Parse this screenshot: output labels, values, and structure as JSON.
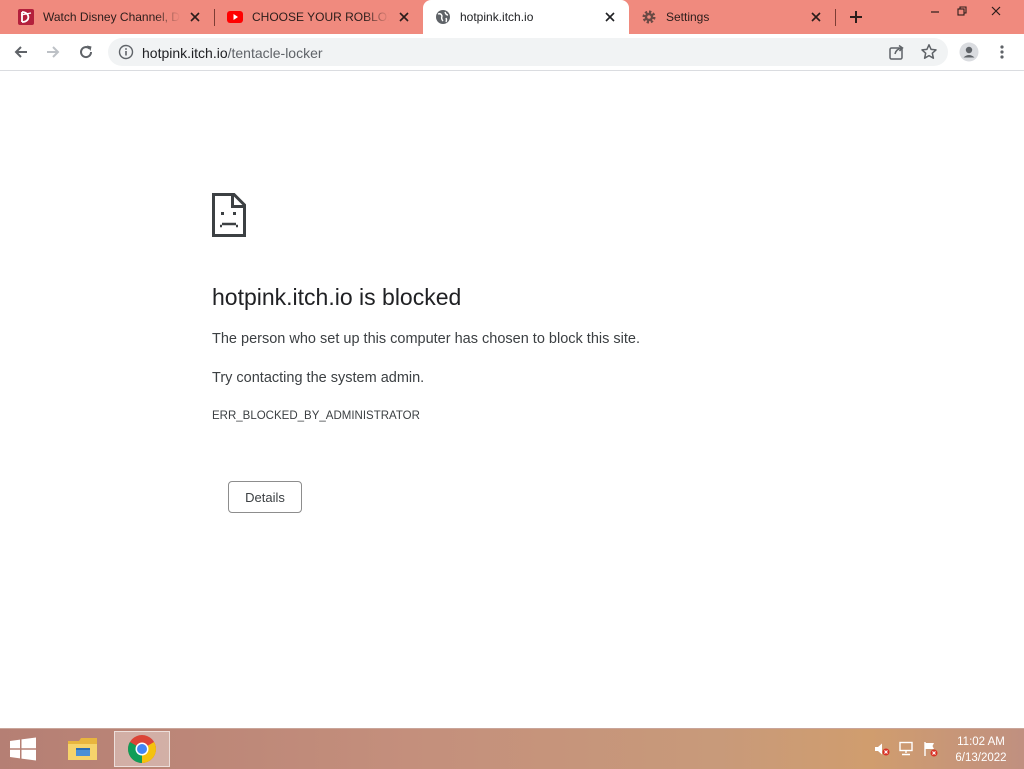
{
  "tabs": [
    {
      "title": "Watch Disney Channel, Disney",
      "icon": "disney-icon",
      "active": false
    },
    {
      "title": "CHOOSE YOUR ROBLOX PI",
      "icon": "youtube-icon",
      "active": false
    },
    {
      "title": "hotpink.itch.io",
      "icon": "globe-icon",
      "active": true
    },
    {
      "title": "Settings",
      "icon": "gear-icon",
      "active": false
    }
  ],
  "address_bar": {
    "host": "hotpink.itch.io",
    "path": "/tentacle-locker"
  },
  "error_page": {
    "heading": "hotpink.itch.io is blocked",
    "message": "The person who set up this computer has chosen to block this site.",
    "suggestion": "Try contacting the system admin.",
    "error_code": "ERR_BLOCKED_BY_ADMINISTRATOR",
    "details_button": "Details"
  },
  "taskbar": {
    "time": "11:02 AM",
    "date": "6/13/2022",
    "pinned": [
      "file-explorer-icon",
      "chrome-icon"
    ]
  },
  "colors": {
    "tabstrip": "#f08a7e",
    "taskbar": "#c48f7c",
    "heading_text": "#202124",
    "body_text": "#3c4043"
  }
}
